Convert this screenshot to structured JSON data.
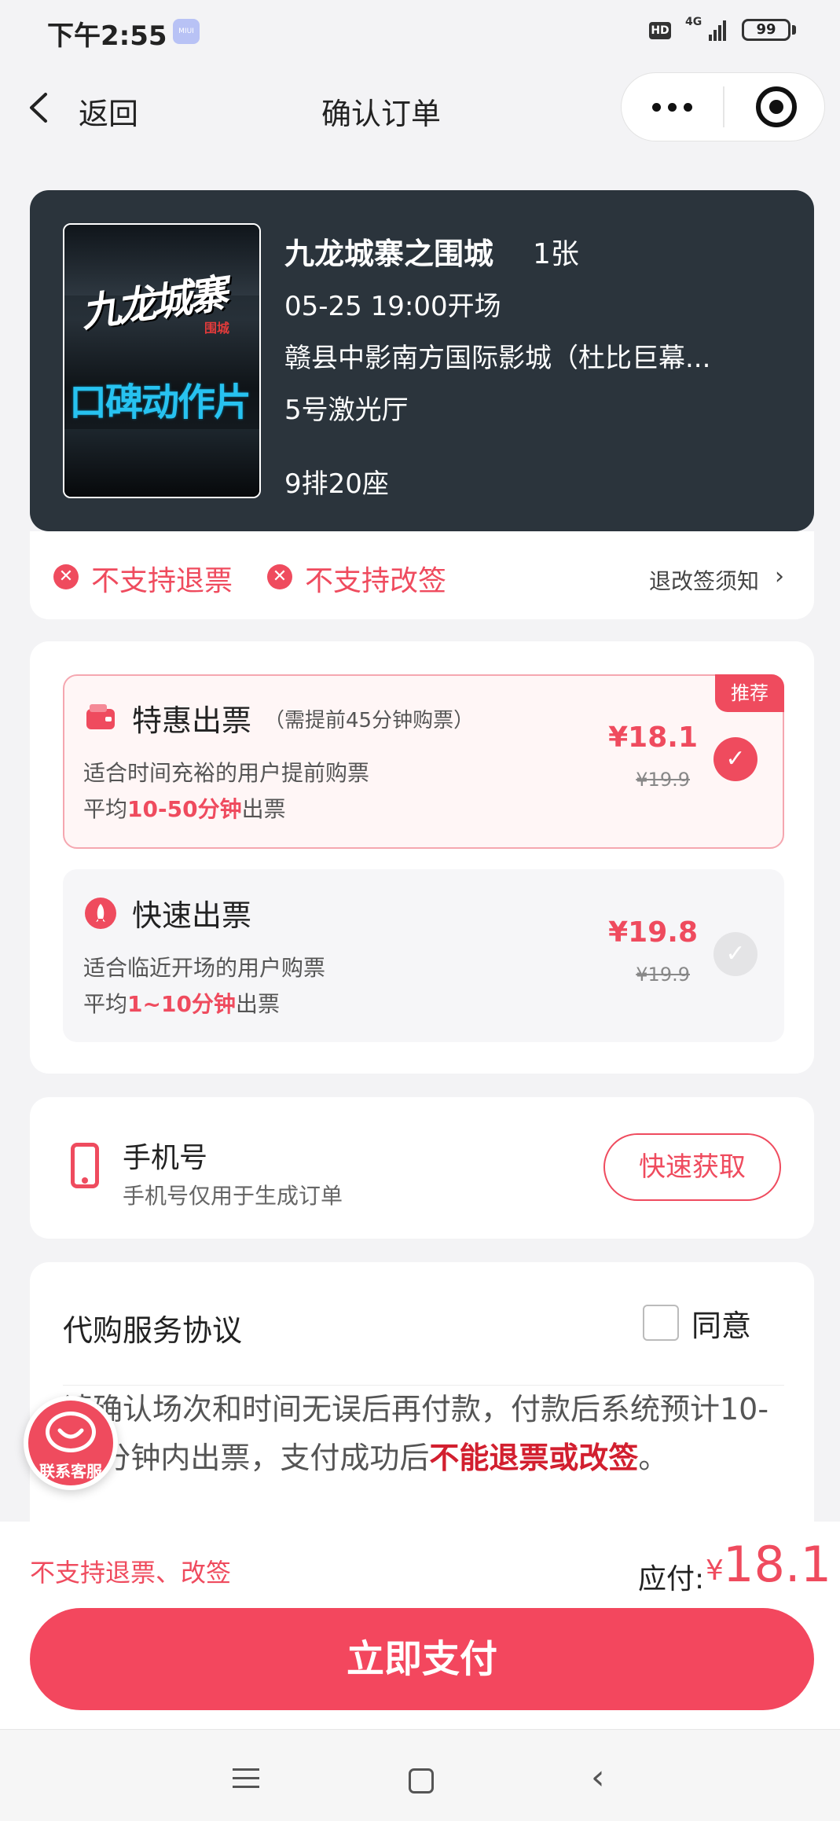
{
  "status_bar": {
    "time": "下午2:55",
    "miui": "MIUI",
    "hd": "HD",
    "network": "4G",
    "battery": "99"
  },
  "nav": {
    "back_label": "返回",
    "title": "确认订单"
  },
  "movie": {
    "poster_title": "九龙城寨",
    "poster_subtitle": "围城",
    "poster_tagline": "口碑动作片",
    "name": "九龙城寨之围城",
    "tickets": "1张",
    "show_time": "05-25 19:00开场",
    "cinema": "赣县中影南方国际影城（杜比巨幕...",
    "hall": "5号激光厅",
    "seat": "9排20座"
  },
  "policy": {
    "no_refund": "不支持退票",
    "no_change": "不支持改签",
    "notice_link": "退改签须知"
  },
  "options": [
    {
      "title": "特惠出票",
      "note": "（需提前45分钟购票）",
      "desc": "适合时间充裕的用户提前购票",
      "time_prefix": "平均",
      "time_highlight": "10-50分钟",
      "time_suffix": "出票",
      "price": "¥18.1",
      "original_price": "¥19.9",
      "badge": "推荐",
      "selected": true
    },
    {
      "title": "快速出票",
      "desc": "适合临近开场的用户购票",
      "time_prefix": "平均",
      "time_highlight": "1~10分钟",
      "time_suffix": "出票",
      "price": "¥19.8",
      "original_price": "¥19.9",
      "selected": false
    }
  ],
  "phone": {
    "label": "手机号",
    "sub": "手机号仅用于生成订单",
    "button": "快速获取"
  },
  "agreement": {
    "title": "代购服务协议",
    "agree_label": "同意",
    "text_part1": "请确认场次和时间无误后再付款，付款后系统预计10-50分钟内出票，支付成功后",
    "text_strong": "不能退票或改签",
    "text_end": "。"
  },
  "service": {
    "label": "联系客服"
  },
  "bottom": {
    "note": "不支持退票、改签",
    "pay_label": "应付:",
    "currency": "¥",
    "amount": "18.1",
    "pay_button": "立即支付"
  },
  "colors": {
    "accent": "#ef4b5e",
    "card_dark": "#2b343c",
    "background": "#f3f3f5"
  }
}
